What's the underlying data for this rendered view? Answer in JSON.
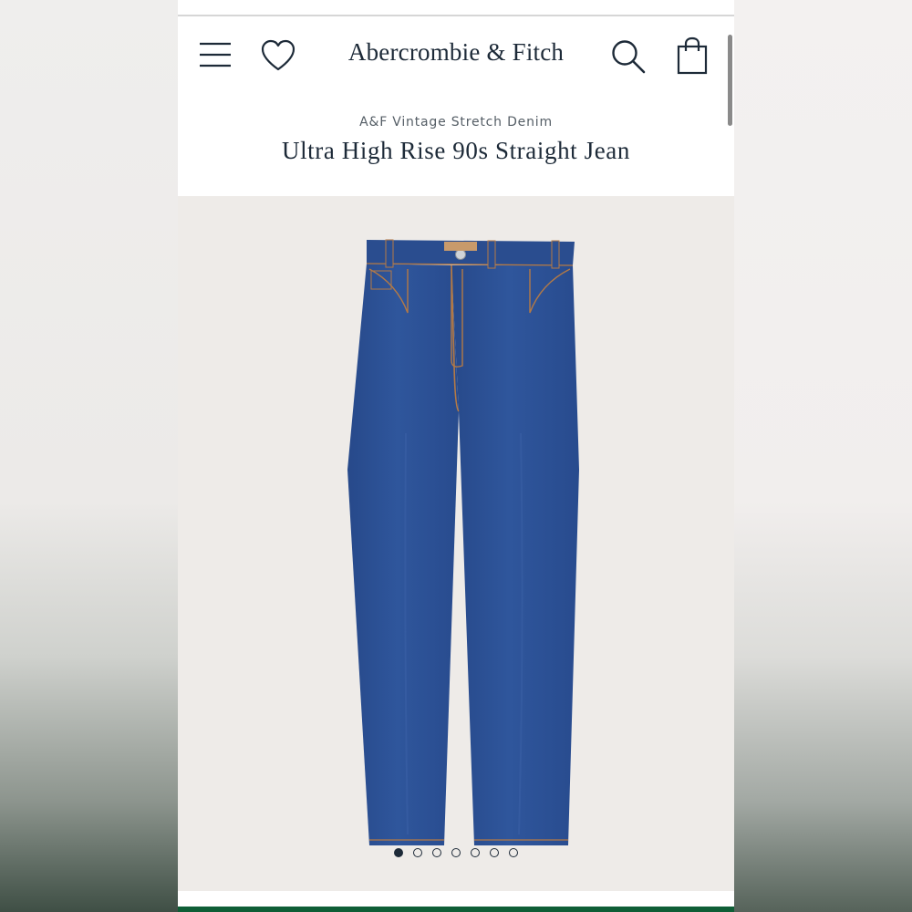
{
  "header": {
    "brand": "Abercrombie & Fitch",
    "icons": [
      "menu-icon",
      "heart-icon",
      "search-icon",
      "bag-icon"
    ]
  },
  "product": {
    "collection": "A&F Vintage Stretch Denim",
    "title": "Ultra High Rise 90s Straight Jean",
    "image_alt": "ultra-high-rise-90s-straight-jean-dark-wash"
  },
  "carousel": {
    "total_slides": 7,
    "active_slide": 1
  },
  "colors": {
    "brand_navy": "#1d2a38",
    "denim": "#2f559a",
    "accent_green": "#0f5e36"
  }
}
